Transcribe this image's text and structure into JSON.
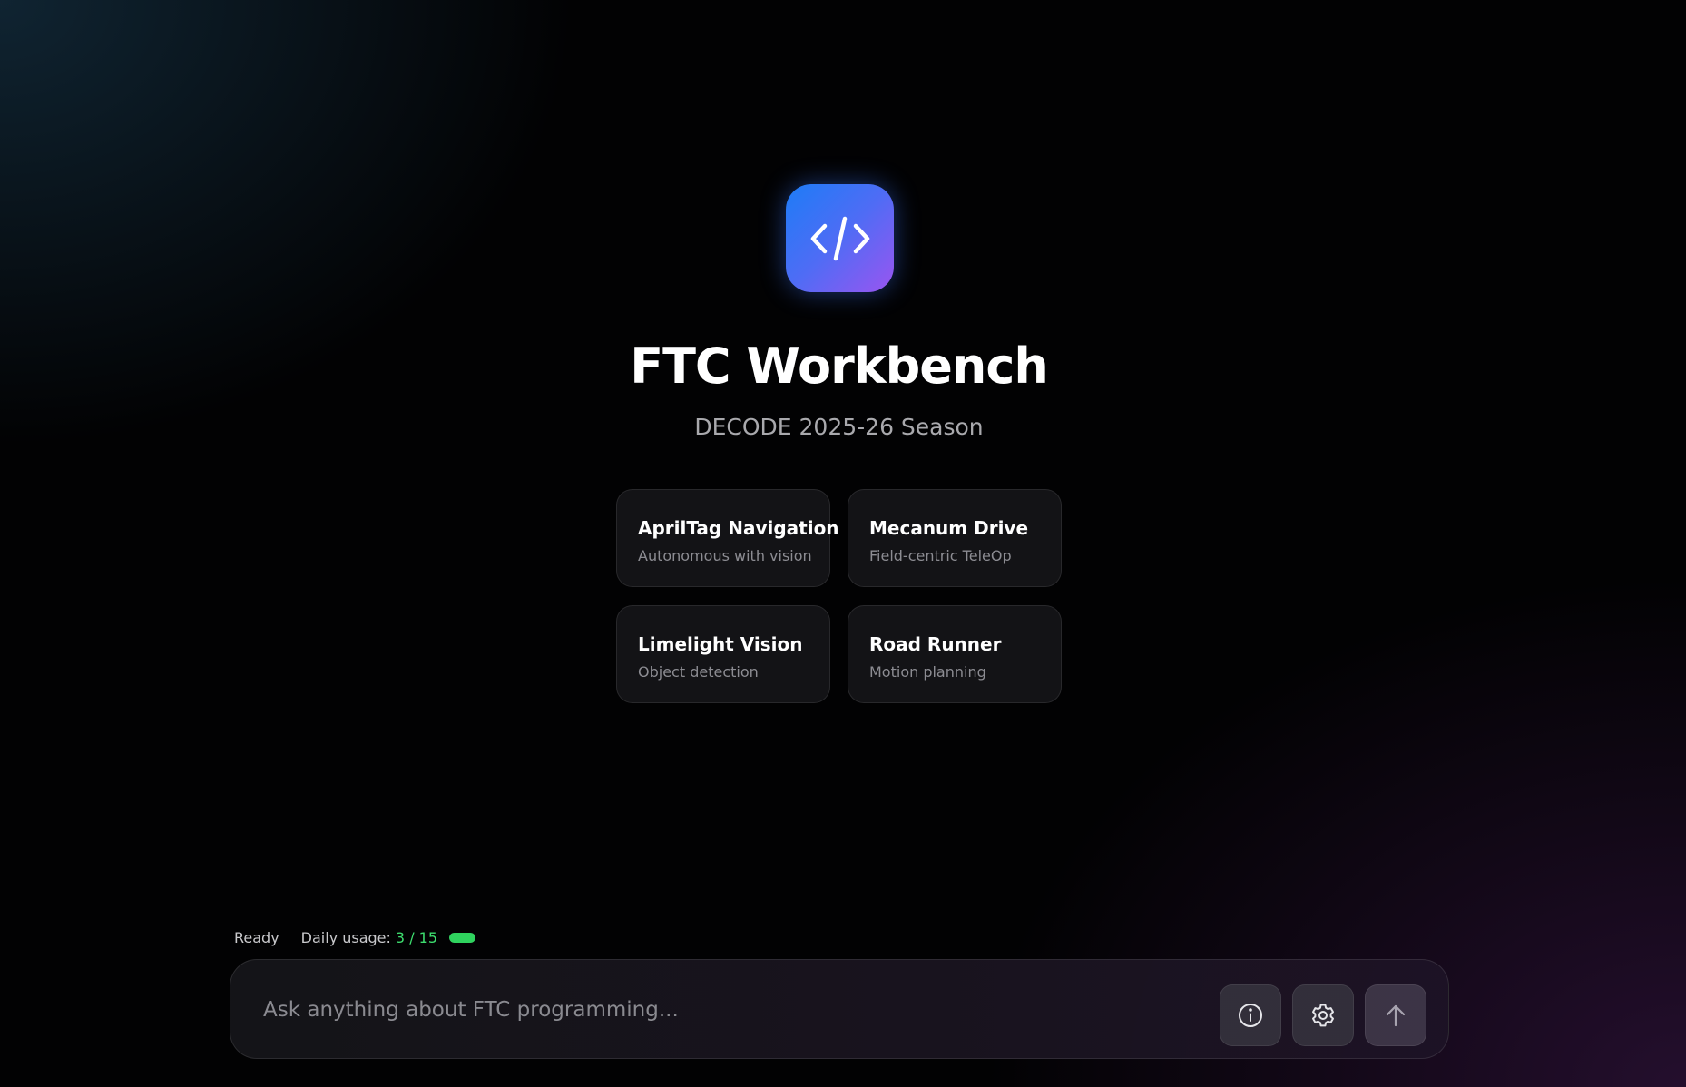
{
  "header": {
    "logo_icon": "code-brackets-icon",
    "title": "FTC Workbench",
    "subtitle": "DECODE 2025-26 Season"
  },
  "cards": [
    {
      "title": "AprilTag Navigation",
      "subtitle": "Autonomous with vision"
    },
    {
      "title": "Mecanum Drive",
      "subtitle": "Field-centric TeleOp"
    },
    {
      "title": "Limelight Vision",
      "subtitle": "Object detection"
    },
    {
      "title": "Road Runner",
      "subtitle": "Motion planning"
    }
  ],
  "status": {
    "state": "Ready",
    "usage_label": "Daily usage:",
    "usage_count": "3 / 15",
    "usage_fraction": 1.0
  },
  "composer": {
    "placeholder": "Ask anything about FTC programming...",
    "info_icon": "info-icon",
    "settings_icon": "gear-icon",
    "send_icon": "arrow-up-icon"
  },
  "colors": {
    "accent_blue": "#1d7cf6",
    "accent_purple": "#9a55f0",
    "usage_green": "#2fd35e",
    "background": "#020203"
  }
}
